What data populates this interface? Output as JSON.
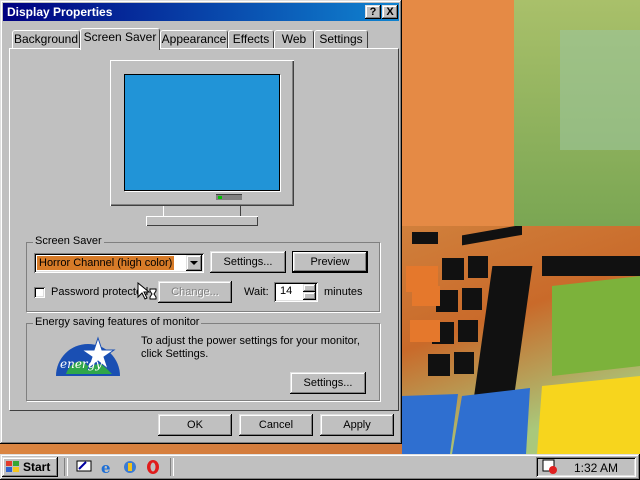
{
  "window": {
    "title": "Display Properties",
    "help_button": "?",
    "close_button": "X"
  },
  "tabs": [
    {
      "label": "Background"
    },
    {
      "label": "Screen Saver"
    },
    {
      "label": "Appearance"
    },
    {
      "label": "Effects"
    },
    {
      "label": "Web"
    },
    {
      "label": "Settings"
    }
  ],
  "screen_saver": {
    "group_label": "Screen Saver",
    "selected": "Horror Channel (high color)",
    "settings_button": "Settings...",
    "preview_button": "Preview",
    "password_label": "Password protected",
    "password_checked": false,
    "change_button": "Change...",
    "wait_label": "Wait:",
    "wait_value": "14",
    "minutes_label": "minutes"
  },
  "energy": {
    "group_label": "Energy saving features of monitor",
    "description": "To adjust the power settings for your monitor, click Settings.",
    "settings_button": "Settings...",
    "logo_text": "energy"
  },
  "dialog_buttons": {
    "ok": "OK",
    "cancel": "Cancel",
    "apply": "Apply"
  },
  "taskbar": {
    "start_label": "Start",
    "clock": "1:32 AM",
    "quick_launch": [
      "desktop-icon",
      "internet-explorer-icon",
      "channels-icon",
      "opera-icon"
    ]
  },
  "colors": {
    "title_bar": "#000080",
    "monitor_screen": "#2194d7",
    "combo_highlight": "#d77b28"
  }
}
